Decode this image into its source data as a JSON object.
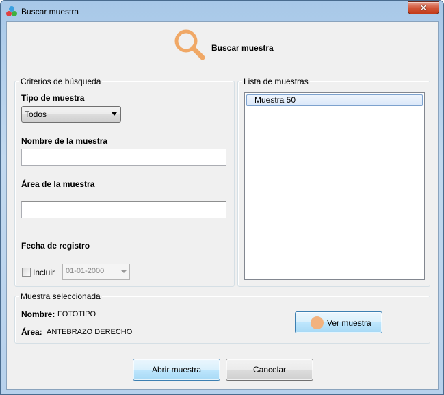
{
  "window": {
    "title": "Buscar muestra",
    "close_glyph": "✕"
  },
  "header": {
    "title": "Buscar muestra",
    "icon": "magnifier-icon",
    "icon_color": "#f0a866"
  },
  "criteria": {
    "group_title": "Criterios de búsqueda",
    "type_label": "Tipo de muestra",
    "type_selected": "Todos",
    "name_label": "Nombre de la muestra",
    "name_value": "",
    "area_label": "Área de la muestra",
    "area_value": "",
    "date_label": "Fecha de registro",
    "include_label": "Incluir",
    "include_checked": false,
    "date_value": "01-01-2000"
  },
  "sample_list": {
    "group_title": "Lista de muestras",
    "items": [
      "Muestra 50"
    ]
  },
  "selected": {
    "group_title": "Muestra seleccionada",
    "name_key": "Nombre:",
    "name_value": "FOTOTIPO",
    "area_key": "Área:",
    "area_value": "ANTEBRAZO DERECHO",
    "view_button": "Ver muestra",
    "view_icon_color": "#f2b27e"
  },
  "footer": {
    "open_button": "Abrir muestra",
    "cancel_button": "Cancelar"
  }
}
